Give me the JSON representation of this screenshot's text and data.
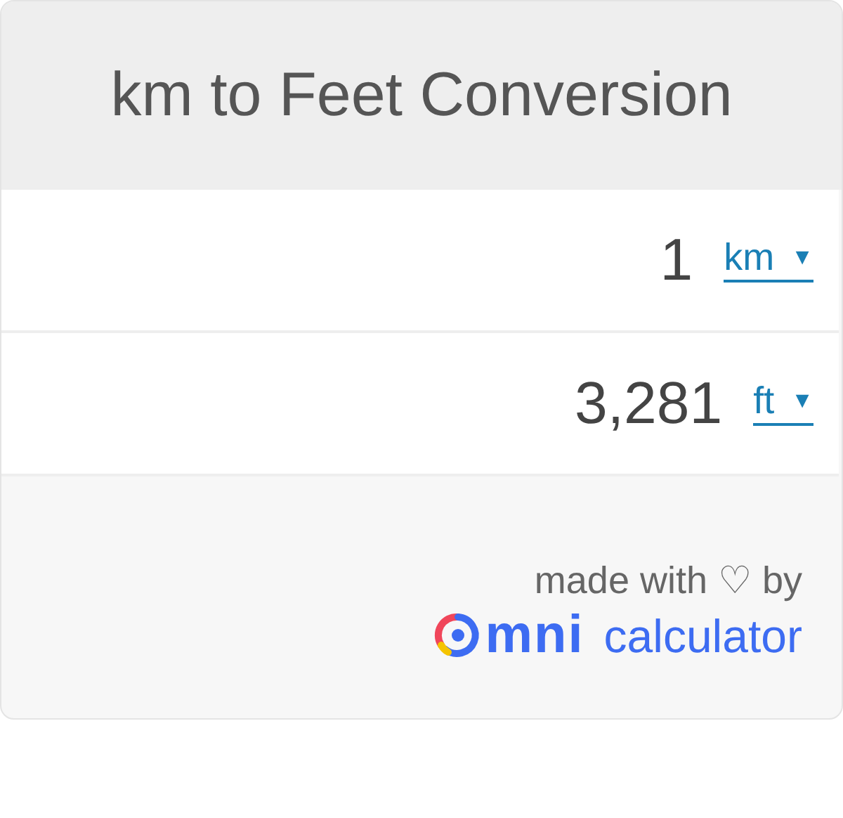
{
  "title": "km to Feet Conversion",
  "rows": [
    {
      "value": "1",
      "unit": "km",
      "caret": "▼"
    },
    {
      "value": "3,281",
      "unit": "ft",
      "caret": "▼"
    }
  ],
  "footer": {
    "credit": "made with ♡ by",
    "logo_word": "mni",
    "logo_sub": "calculator"
  }
}
